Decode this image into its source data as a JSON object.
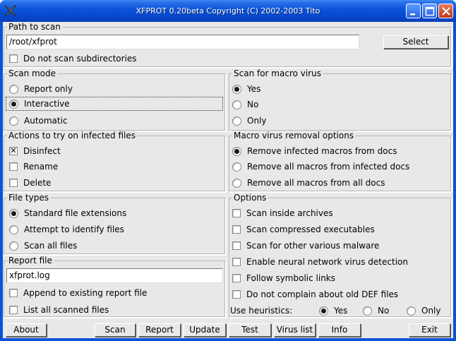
{
  "window": {
    "title": "XFPROT 0.20beta Copyright (C) 2002-2003 Tito",
    "icon": "xf-logo-icon",
    "controls": [
      "minimize-icon",
      "maximize-icon",
      "close-icon"
    ]
  },
  "path_to_scan": {
    "title": "Path to scan",
    "value": "/root/xfprot",
    "select_label": "Select",
    "no_subdirs_label": "Do not scan subdirectories",
    "no_subdirs_checked": false
  },
  "scan_mode": {
    "title": "Scan mode",
    "options": [
      {
        "label": "Report only",
        "selected": false
      },
      {
        "label": "Interactive",
        "selected": true
      },
      {
        "label": "Automatic",
        "selected": false
      }
    ]
  },
  "macro_virus": {
    "title": "Scan for macro virus",
    "options": [
      {
        "label": "Yes",
        "selected": true
      },
      {
        "label": "No",
        "selected": false
      },
      {
        "label": "Only",
        "selected": false
      }
    ]
  },
  "actions": {
    "title": "Actions to try on infected files",
    "options": [
      {
        "label": "Disinfect",
        "checked": true
      },
      {
        "label": "Rename",
        "checked": false
      },
      {
        "label": "Delete",
        "checked": false
      }
    ]
  },
  "macro_removal": {
    "title": "Macro virus removal options",
    "options": [
      {
        "label": "Remove infected macros from docs",
        "selected": true
      },
      {
        "label": "Remove all macros from infected docs",
        "selected": false
      },
      {
        "label": "Remove all macros from all docs",
        "selected": false
      }
    ]
  },
  "file_types": {
    "title": "File types",
    "options": [
      {
        "label": "Standard file extensions",
        "selected": true
      },
      {
        "label": "Attempt to identify files",
        "selected": false
      },
      {
        "label": "Scan all files",
        "selected": false
      }
    ]
  },
  "options": {
    "title": "Options",
    "items": [
      {
        "label": "Scan inside archives",
        "checked": false
      },
      {
        "label": "Scan compressed executables",
        "checked": false
      },
      {
        "label": "Scan for other various malware",
        "checked": false
      },
      {
        "label": "Enable neural network virus detection",
        "checked": false
      },
      {
        "label": "Follow symbolic links",
        "checked": false
      },
      {
        "label": "Do not complain about old DEF files",
        "checked": false
      }
    ],
    "heuristics_label": "Use heuristics:",
    "heuristics": [
      {
        "label": "Yes",
        "selected": true
      },
      {
        "label": "No",
        "selected": false
      },
      {
        "label": "Only",
        "selected": false
      }
    ]
  },
  "report_file": {
    "title": "Report file",
    "value": "xfprot.log",
    "append_label": "Append to existing report file",
    "append_checked": false,
    "list_all_label": "List all scanned files",
    "list_all_checked": false
  },
  "buttons": {
    "about": "About",
    "scan": "Scan",
    "report": "Report",
    "update": "Update",
    "test": "Test",
    "virus_list": "Virus list",
    "info": "Info",
    "exit": "Exit"
  }
}
